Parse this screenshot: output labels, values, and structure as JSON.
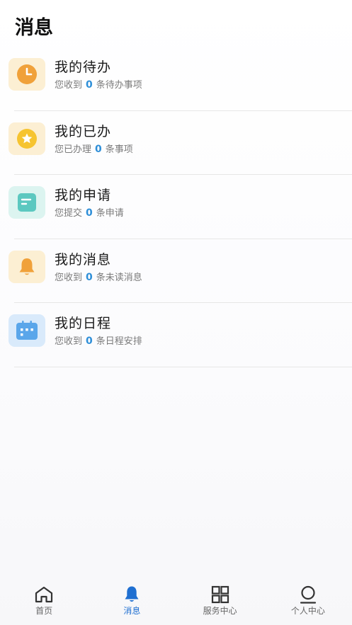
{
  "page": {
    "title": "消息"
  },
  "colors": {
    "accent": "#2f8fd8",
    "tab_active": "#1f6fd1",
    "tab_inactive": "#333333"
  },
  "items": [
    {
      "title": "我的待办",
      "sub_prefix": "您收到",
      "count": "0",
      "sub_suffix": "条待办事项",
      "icon": "clock-icon",
      "icon_bg": "#fcefd3",
      "icon_color": "#f0a13a"
    },
    {
      "title": "我的已办",
      "sub_prefix": "您已办理",
      "count": "0",
      "sub_suffix": "条事项",
      "icon": "star-icon",
      "icon_bg": "#fcefd3",
      "icon_color": "#f6c430"
    },
    {
      "title": "我的申请",
      "sub_prefix": "您提交",
      "count": "0",
      "sub_suffix": "条申请",
      "icon": "document-icon",
      "icon_bg": "#dcf4f0",
      "icon_color": "#5cc8c0"
    },
    {
      "title": "我的消息",
      "sub_prefix": "您收到",
      "count": "0",
      "sub_suffix": "条未读消息",
      "icon": "bell-icon",
      "icon_bg": "#fcefd3",
      "icon_color": "#f0a13a"
    },
    {
      "title": "我的日程",
      "sub_prefix": "您收到",
      "count": "0",
      "sub_suffix": "条日程安排",
      "icon": "calendar-icon",
      "icon_bg": "#d9eafb",
      "icon_color": "#5aa6ea"
    }
  ],
  "tabbar": {
    "active": "messages",
    "tabs": [
      {
        "key": "home",
        "label": "首页",
        "icon": "home-icon"
      },
      {
        "key": "messages",
        "label": "消息",
        "icon": "bell-icon"
      },
      {
        "key": "services",
        "label": "服务中心",
        "icon": "grid-icon"
      },
      {
        "key": "profile",
        "label": "个人中心",
        "icon": "user-icon"
      }
    ]
  }
}
